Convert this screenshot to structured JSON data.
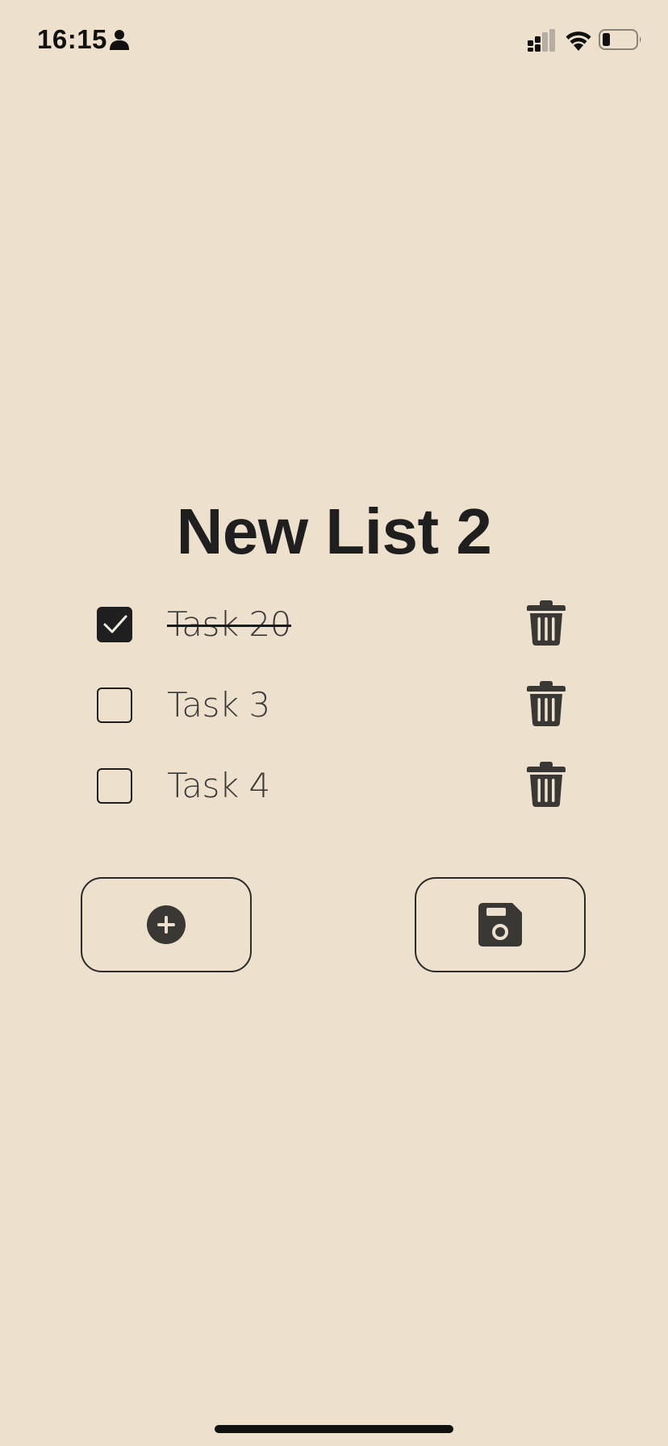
{
  "status_bar": {
    "time": "16:15",
    "icons": [
      "person-icon",
      "cellular-signal-icon",
      "wifi-icon",
      "battery-icon"
    ]
  },
  "list": {
    "title": "New List 2",
    "tasks": [
      {
        "label": "Task 20",
        "checked": true
      },
      {
        "label": "Task 3",
        "checked": false
      },
      {
        "label": "Task 4",
        "checked": false
      }
    ]
  },
  "actions": {
    "add_icon": "plus-circle-icon",
    "save_icon": "floppy-disk-icon"
  },
  "colors": {
    "background": "#ede0cc",
    "text": "#1f1f1f",
    "icon": "#3a3834"
  }
}
